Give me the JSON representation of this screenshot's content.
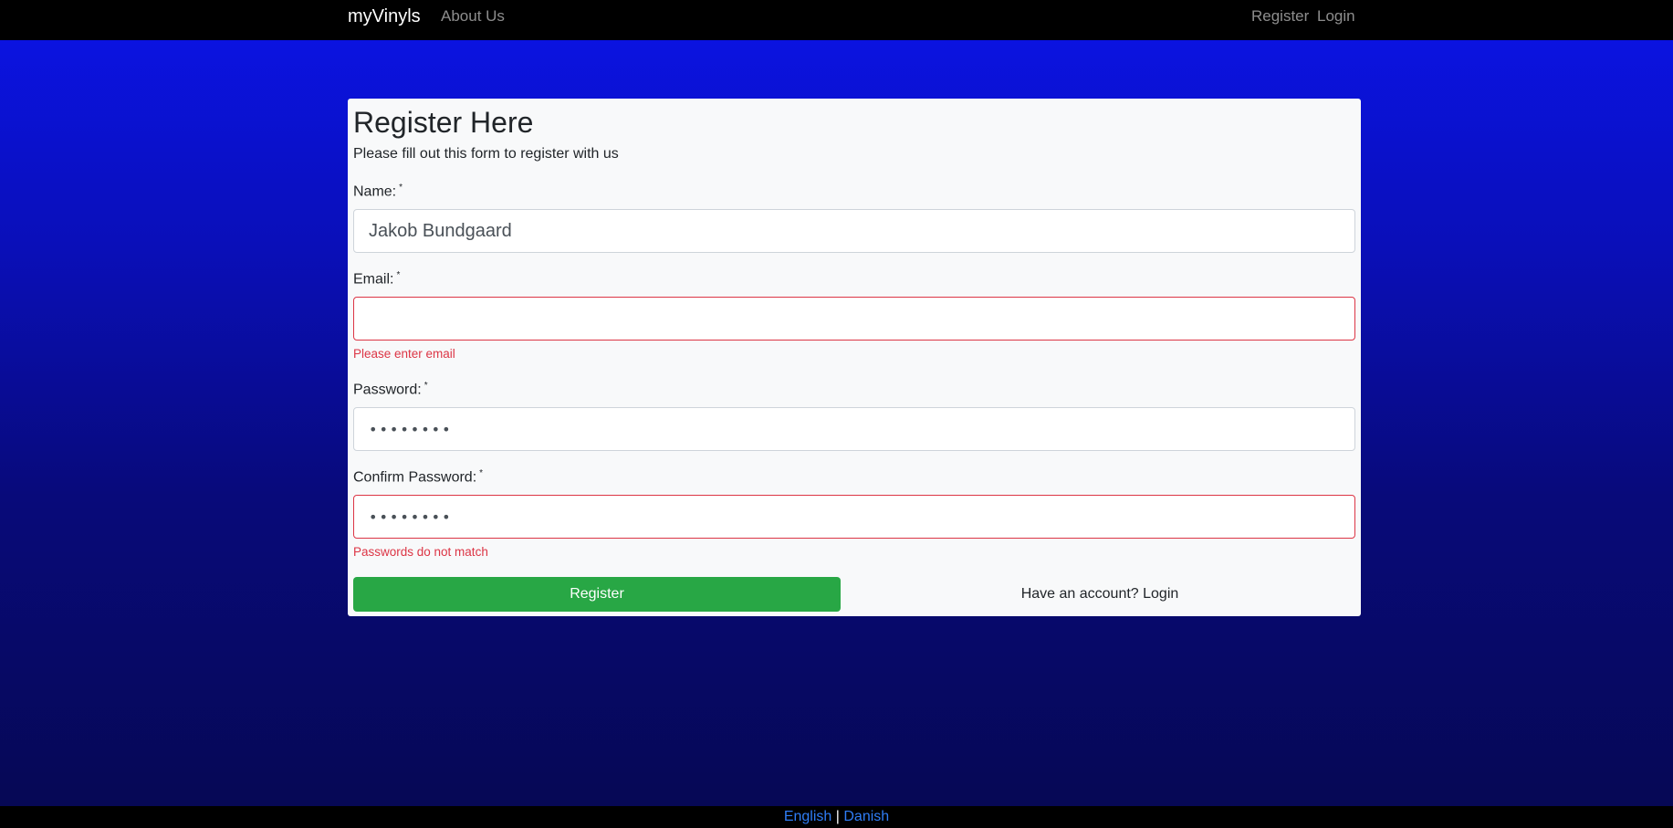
{
  "navbar": {
    "brand": "myVinyls",
    "about_label": "About Us",
    "register_label": "Register",
    "login_label": "Login"
  },
  "form": {
    "title": "Register Here",
    "subtitle": "Please fill out this form to register with us",
    "required_marker": "*",
    "name": {
      "label": "Name:",
      "value": "Jakob Bundgaard"
    },
    "email": {
      "label": "Email:",
      "value": "",
      "error": "Please enter email"
    },
    "password": {
      "label": "Password:",
      "value": "••••••••"
    },
    "confirm_password": {
      "label": "Confirm Password:",
      "value": "••••••••",
      "error": "Passwords do not match"
    },
    "submit_label": "Register",
    "login_prompt": "Have an account? Login"
  },
  "footer": {
    "english_label": "English",
    "separator": "|",
    "danish_label": "Danish"
  },
  "colors": {
    "navbar_bg": "#000000",
    "submit_button": "#28a745",
    "error": "#dc3545",
    "footer_link": "#2f7df6"
  }
}
